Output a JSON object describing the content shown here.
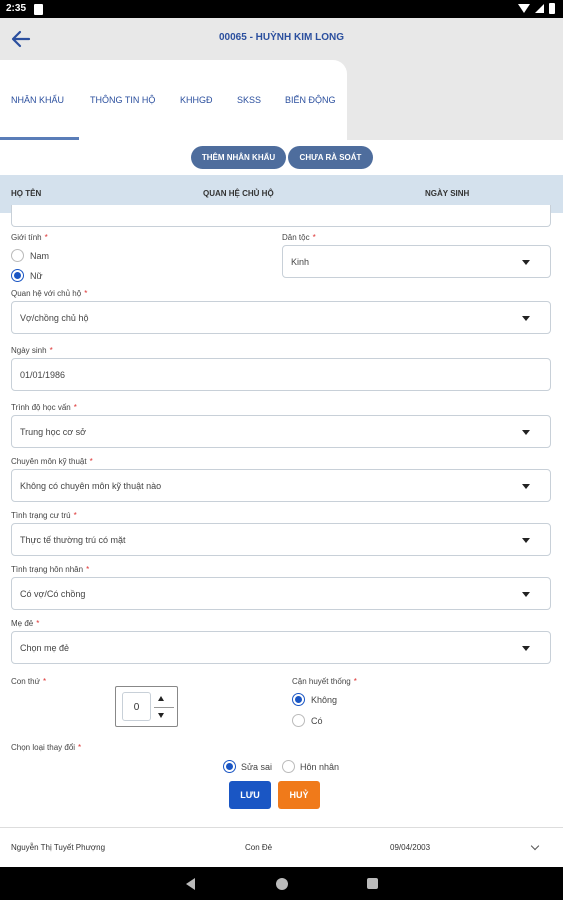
{
  "status": {
    "time": "2:35"
  },
  "header": {
    "title": "00065 - HUỲNH KIM LONG"
  },
  "tabs": [
    {
      "label": "NHÂN KHẨU"
    },
    {
      "label": "THÔNG TIN HỘ"
    },
    {
      "label": "KHHGĐ"
    },
    {
      "label": "SKSS"
    },
    {
      "label": "BIẾN ĐỘNG"
    }
  ],
  "actions": {
    "add_member": "THÊM NHÂN KHẨU",
    "not_reviewed": "CHƯA RÀ SOÁT"
  },
  "table_header": {
    "name": "HỌ TÊN",
    "relation": "QUAN HỆ CHỦ HỘ",
    "dob": "NGÀY SINH"
  },
  "form": {
    "gender": {
      "label": "Giới tính",
      "options": [
        "Nam",
        "Nữ"
      ],
      "selected": "Nữ"
    },
    "ethnicity": {
      "label": "Dân tộc",
      "value": "Kinh"
    },
    "relation": {
      "label": "Quan hệ với chủ hộ",
      "value": "Vợ/chồng chủ hộ"
    },
    "dob": {
      "label": "Ngày sinh",
      "value": "01/01/1986"
    },
    "education": {
      "label": "Trình độ học vấn",
      "value": "Trung học cơ sở"
    },
    "technical": {
      "label": "Chuyên môn kỹ thuật",
      "value": "Không có chuyên môn kỹ thuật nào"
    },
    "residence": {
      "label": "Tình trạng cư trú",
      "value": "Thực tế thường trú có mặt"
    },
    "marital": {
      "label": "Tình trạng hôn nhân",
      "value": "Có vợ/Có chồng"
    },
    "mother": {
      "label": "Mẹ đẻ",
      "value": "Chọn mẹ đẻ"
    },
    "child_order": {
      "label": "Con thứ",
      "value": "0"
    },
    "blood": {
      "label": "Cận huyết thống",
      "options": [
        "Không",
        "Có"
      ],
      "selected": "Không"
    },
    "change_type": {
      "label": "Chọn loại thay đổi",
      "options": [
        "Sửa sai",
        "Hôn nhân"
      ],
      "selected": "Sửa sai"
    },
    "required_mark": "*"
  },
  "buttons": {
    "save": "LƯU",
    "cancel": "HUỶ",
    "save_color": "#1a56c4",
    "cancel_color": "#f07a1a"
  },
  "row": {
    "name": "Nguyễn Thị Tuyết Phượng",
    "relation": "Con Đẻ",
    "dob": "09/04/2003"
  }
}
